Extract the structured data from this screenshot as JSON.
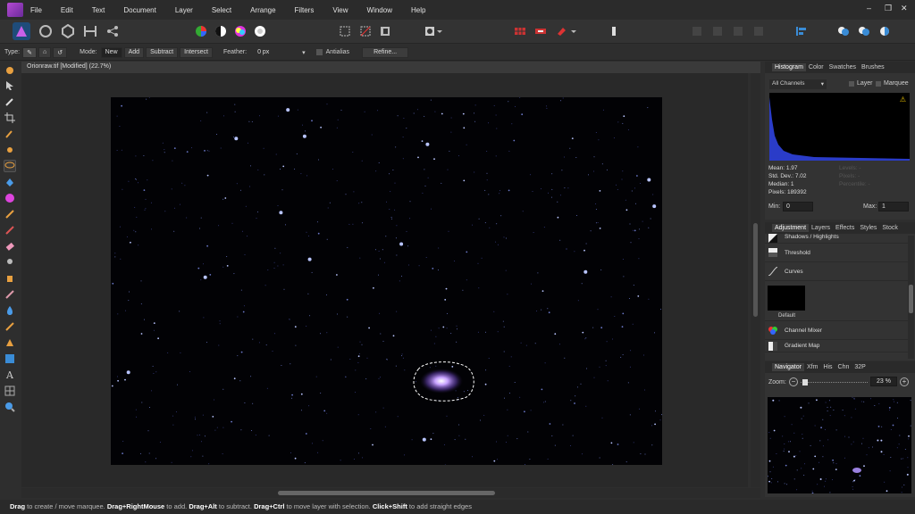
{
  "menubar": {
    "items": [
      "File",
      "Edit",
      "Text",
      "Document",
      "Layer",
      "Select",
      "Arrange",
      "Filters",
      "View",
      "Window",
      "Help"
    ],
    "window_controls": [
      "–",
      "❒",
      "✕"
    ]
  },
  "context_toolbar": {
    "type_label": "Type:",
    "mode_label": "Mode:",
    "modes": [
      "New",
      "Add",
      "Subtract",
      "Intersect"
    ],
    "feather_label": "Feather:",
    "feather_value": "0 px",
    "antialias_label": "Antialias",
    "refine_label": "Refine..."
  },
  "document": {
    "tab_title": "Orionraw.tif [Modified] (22.7%)"
  },
  "histogram": {
    "tabs": [
      "Histogram",
      "Color",
      "Swatches",
      "Brushes"
    ],
    "channels_value": "All Channels",
    "layer_label": "Layer",
    "marquee_label": "Marquee",
    "mean": "Mean: 1.97",
    "std_dev": "Std. Dev.: 7.02",
    "median": "Median: 1",
    "pixels": "Pixels: 189392",
    "right_stats": [
      "Levels: -",
      "Pixels: -",
      "Percentile: -"
    ],
    "min_label": "Min:",
    "min_value": "0",
    "max_label": "Max:",
    "max_value": "1",
    "warning_icon": "warning-icon",
    "graph_color": "#2a3cc8"
  },
  "adjustment": {
    "tabs": [
      "Adjustment",
      "Layers",
      "Effects",
      "Styles",
      "Stock"
    ],
    "items": [
      "Shadows / Highlights",
      "Threshold",
      "Curves"
    ],
    "preset_label": "Default",
    "items_after": [
      "Channel Mixer",
      "Gradient Map"
    ]
  },
  "navigator": {
    "tabs": [
      "Navigator",
      "Xfm",
      "His",
      "Chn",
      "32P"
    ],
    "zoom_label": "Zoom:",
    "zoom_value": "23 %"
  },
  "status": {
    "k1": "Drag",
    "t1": " to create / move marquee. ",
    "k2": "Drag+RightMouse",
    "t2": " to add. ",
    "k3": "Drag+Alt",
    "t3": " to subtract. ",
    "k4": "Drag+Ctrl",
    "t4": " to move layer with selection. ",
    "k5": "Click+Shift",
    "t5": " to add straight edges"
  },
  "colors": {
    "accent": "#1e4c7a",
    "selection_outline": "#ffffff",
    "nebula": "#c6a0ff"
  }
}
